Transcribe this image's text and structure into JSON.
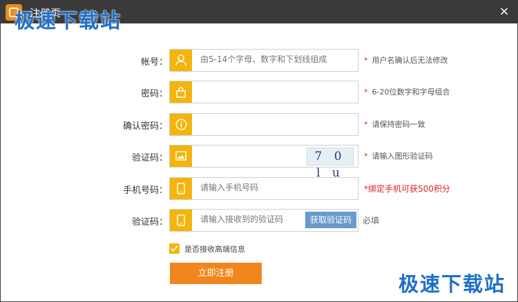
{
  "window": {
    "title": "注册页",
    "close_glyph": "×"
  },
  "watermark": {
    "top": "极速下载站",
    "bottom": "极速下载站"
  },
  "form": {
    "account": {
      "label": "帐号：",
      "placeholder": "由5-14个字母、数字和下划线组成",
      "hint_star": "*",
      "hint": "用户名确认后无法修改",
      "icon": "user-icon"
    },
    "password": {
      "label": "密码：",
      "placeholder": "",
      "hint_star": "*",
      "hint": "6-20位数字和字母组合",
      "icon": "lock-icon"
    },
    "confirm_password": {
      "label": "确认密码：",
      "placeholder": "",
      "hint_star": "*",
      "hint": "请保持密码一致",
      "icon": "info-icon"
    },
    "captcha": {
      "label": "验证码：",
      "placeholder": "",
      "captcha_text": "7 0 l u",
      "hint_star": "*",
      "hint": "请输入图形验证码",
      "icon": "image-icon"
    },
    "phone": {
      "label": "手机号码：",
      "placeholder": "请输入手机号码",
      "hint": "*绑定手机可获500积分",
      "icon": "phone-icon"
    },
    "sms_code": {
      "label": "验证码：",
      "placeholder": "请输入接收到的验证码",
      "button": "获取验证码",
      "required": "必填",
      "icon": "phone-icon"
    },
    "subscribe": {
      "label": "是否接收高端信息",
      "checked": true
    },
    "submit": "立即注册"
  },
  "colors": {
    "accent": "#f5b40b",
    "button": "#f0871e",
    "titlebar": "#3a3a3a",
    "watermark": "#1e6fc9",
    "error": "#e02020"
  }
}
